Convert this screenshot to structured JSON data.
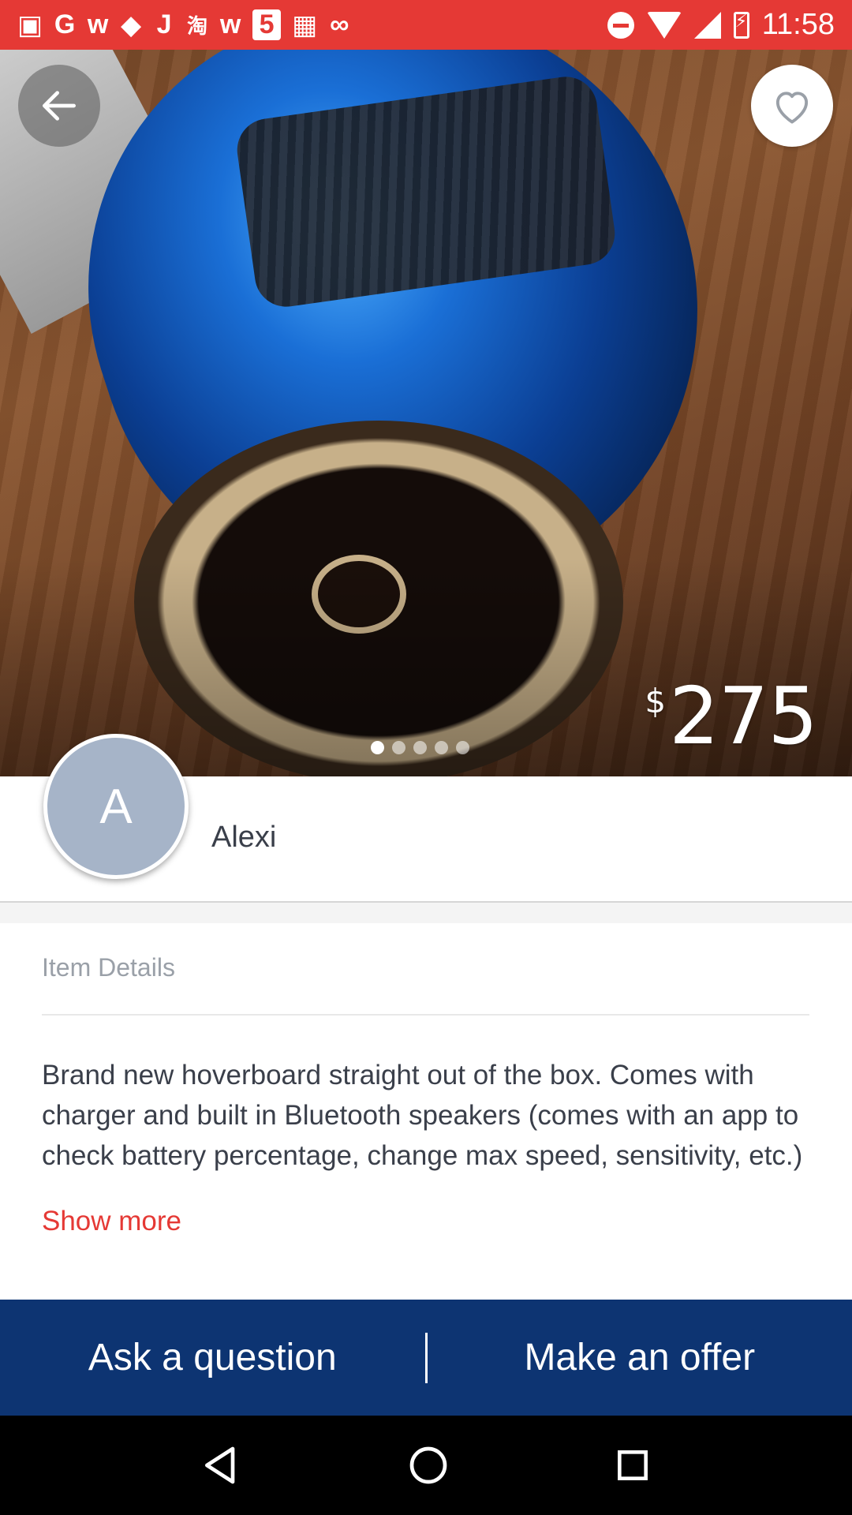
{
  "status_bar": {
    "app_icons": [
      "G",
      "w",
      "J",
      "淘",
      "w",
      "5"
    ],
    "time": "11:58"
  },
  "listing": {
    "price_currency": "$",
    "price_amount": "275",
    "photo_count": 5,
    "active_photo_index": 0
  },
  "seller": {
    "avatar_initial": "A",
    "name": "Alexi"
  },
  "details": {
    "heading": "Item Details",
    "description": "Brand new hoverboard straight out of the box. Comes with charger and built in Bluetooth speakers (comes with an app to check battery percentage, change max speed, sensitivity, etc.)",
    "show_more": "Show more"
  },
  "actions": {
    "ask_question": "Ask a question",
    "make_offer": "Make an offer"
  },
  "colors": {
    "status_bar": "#e53935",
    "accent_red": "#e53935",
    "action_bar": "#0d3472",
    "avatar": "#a6b4c8"
  },
  "icons": {
    "back": "arrow-left-icon",
    "favorite": "heart-outline-icon",
    "nav_back": "triangle-back-icon",
    "nav_home": "circle-home-icon",
    "nav_recents": "square-recents-icon"
  }
}
